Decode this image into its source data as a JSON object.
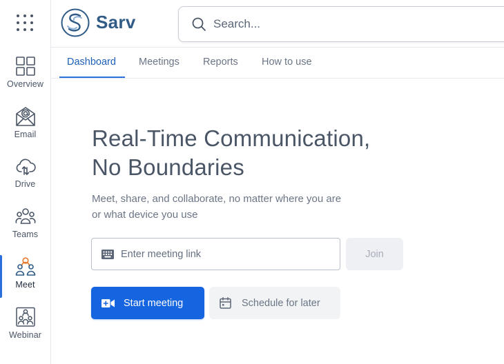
{
  "brand": {
    "name": "Sarv"
  },
  "search": {
    "placeholder": "Search..."
  },
  "rail": {
    "items": [
      {
        "label": "Overview",
        "icon": "overview-grid-icon"
      },
      {
        "label": "Email",
        "icon": "email-icon"
      },
      {
        "label": "Drive",
        "icon": "cloud-drive-icon"
      },
      {
        "label": "Teams",
        "icon": "teams-icon"
      },
      {
        "label": "Meet",
        "icon": "meet-icon",
        "active": true
      },
      {
        "label": "Webinar",
        "icon": "webinar-icon"
      }
    ]
  },
  "tabs": [
    {
      "label": "Dashboard",
      "active": true
    },
    {
      "label": "Meetings"
    },
    {
      "label": "Reports"
    },
    {
      "label": "How to use"
    }
  ],
  "hero": {
    "title_line1": "Real-Time Communication,",
    "title_line2": "No Boundaries",
    "subtitle_line1": "Meet, share, and collaborate, no matter where you are",
    "subtitle_line2": "or what device you use"
  },
  "meeting": {
    "link_placeholder": "Enter meeting link",
    "join_label": "Join",
    "start_label": "Start meeting",
    "schedule_label": "Schedule for later"
  },
  "colors": {
    "accent": "#1565e0",
    "active_indicator": "#2a6fdb",
    "brand_text": "#2f5b86",
    "meet_icon_accent": "#e8782a"
  }
}
